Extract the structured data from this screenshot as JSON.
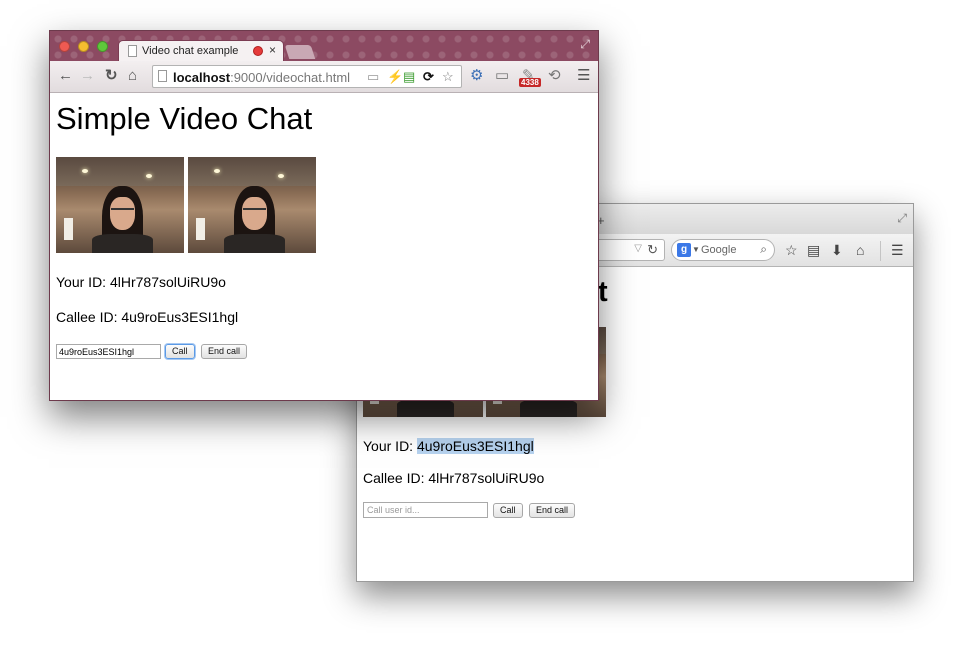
{
  "firefox": {
    "new_tab_symbol": "+",
    "fullscreen_symbol": "⤢",
    "search_engine": "Google",
    "search_logo_letter": "g",
    "page": {
      "title_visible_tail": "t",
      "your_id_label": "Your ID: ",
      "your_id_value": "4u9roEus3ESI1hgl",
      "callee_id_text": "Callee ID: 4lHr787solUiRU9o",
      "input_placeholder": "Call user id...",
      "call_button": "Call",
      "end_call_button": "End call"
    }
  },
  "chrome": {
    "tab_title": "Video chat example",
    "tab_close": "×",
    "url_host": "localhost",
    "url_rest": ":9000/videochat.html",
    "badge_count": "4338",
    "page": {
      "heading": "Simple Video Chat",
      "your_id_text": "Your ID: 4lHr787solUiRU9o",
      "callee_id_text": "Callee ID: 4u9roEus3ESI1hgl",
      "input_value": "4u9roEus3ESI1hgl",
      "call_button": "Call",
      "end_call_button": "End call"
    }
  },
  "colors": {
    "chrome_theme": "#8c4a62",
    "selection_highlight": "#b6d2ef",
    "focus_ring": "#5b9ae6"
  }
}
